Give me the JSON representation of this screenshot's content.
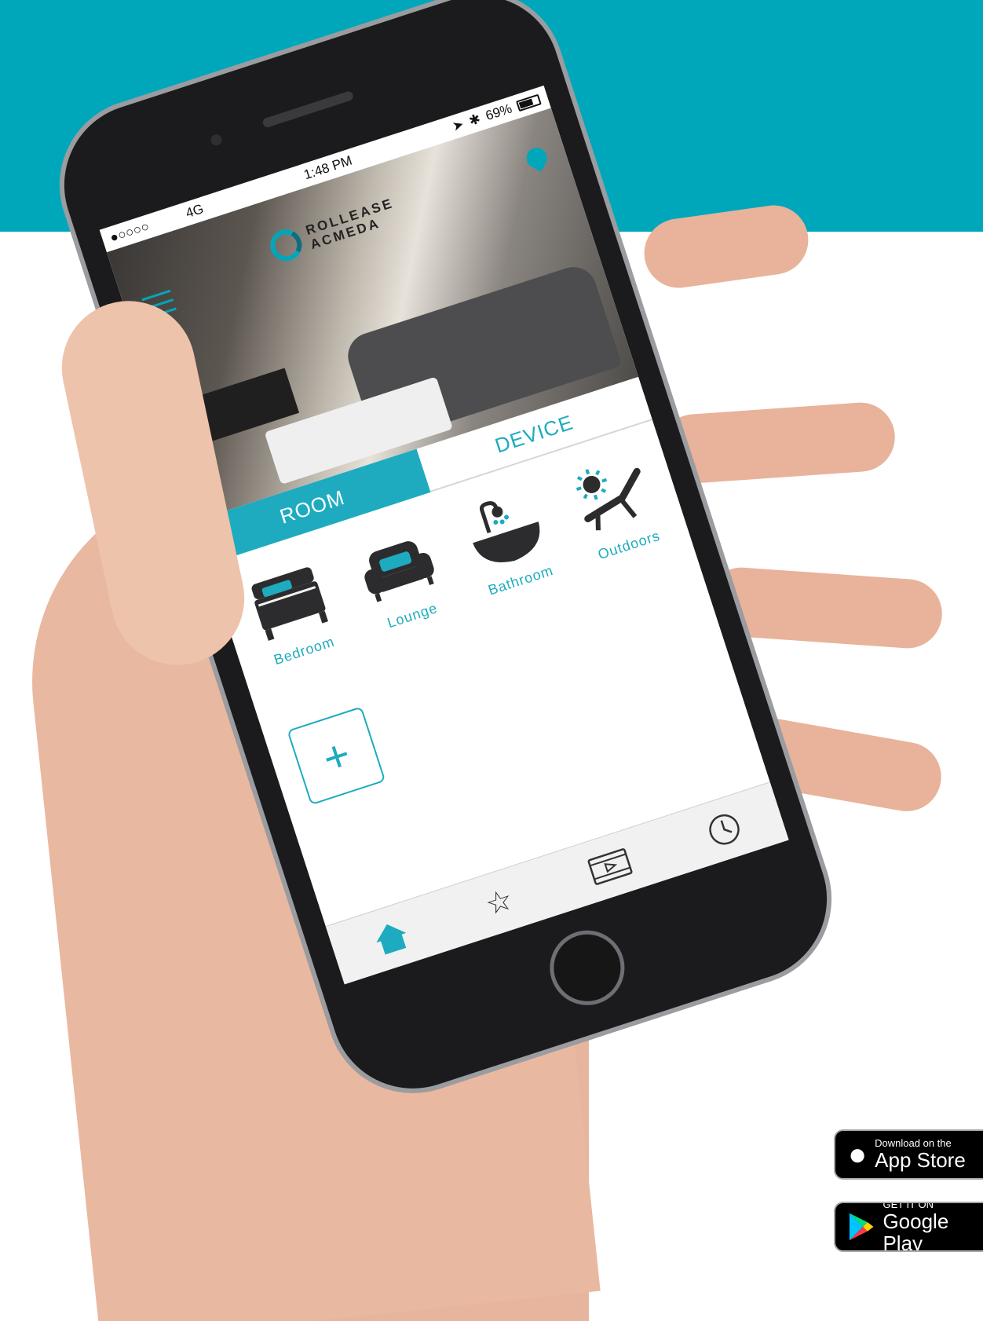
{
  "colors": {
    "brand_teal": "#00a7bb",
    "tab_teal": "#1eabbf",
    "icon_dark": "#2c2c2e"
  },
  "status_bar": {
    "signal": "●○○○○",
    "carrier": "4G",
    "time": "1:48 PM",
    "battery": "69%"
  },
  "brand": {
    "line1": "ROLLEASE",
    "line2": "ACMEDA"
  },
  "header_icons": {
    "menu": "hamburger-menu-icon",
    "location": "location-pin-icon"
  },
  "tabs": [
    {
      "label": "ROOM",
      "active": true
    },
    {
      "label": "DEVICE",
      "active": false
    }
  ],
  "rooms": [
    {
      "label": "Bedroom",
      "icon": "bed-icon"
    },
    {
      "label": "Lounge",
      "icon": "sofa-icon"
    },
    {
      "label": "Bathroom",
      "icon": "bathtub-shower-icon"
    },
    {
      "label": "Outdoors",
      "icon": "sun-lounger-icon"
    }
  ],
  "add_room": {
    "symbol": "+"
  },
  "bottom_nav": [
    {
      "icon": "home-icon",
      "active": true
    },
    {
      "icon": "star-icon",
      "active": false
    },
    {
      "icon": "film-scene-icon",
      "active": false
    },
    {
      "icon": "clock-icon",
      "active": false
    }
  ],
  "store_badges": {
    "app_store": {
      "small": "Download on the",
      "big": "App Store"
    },
    "google_play": {
      "small": "GET IT ON",
      "big": "Google Play"
    }
  }
}
